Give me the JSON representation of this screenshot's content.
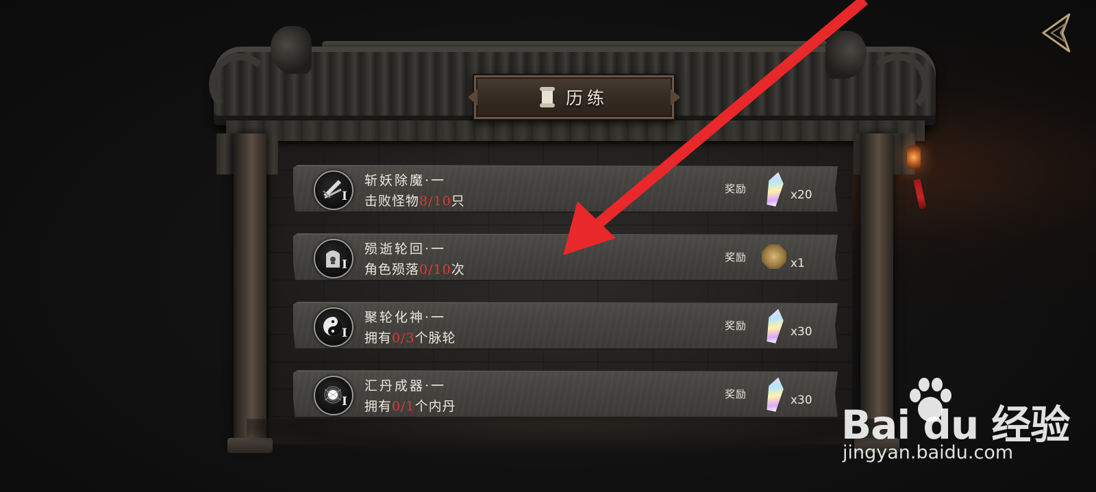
{
  "title": "历练",
  "tasks": [
    {
      "name": "斩妖除魔·一",
      "desc_prefix": "击败怪物",
      "progress": "8/10",
      "desc_suffix": "只",
      "roman": "I",
      "icon": "blade-icon",
      "reward_label": "奖励",
      "reward_item": "crystal-icon",
      "reward_qty": "x20"
    },
    {
      "name": "殒逝轮回·一",
      "desc_prefix": "角色殒落",
      "progress": "0/10",
      "desc_suffix": "次",
      "roman": "I",
      "icon": "tombstone-icon",
      "reward_label": "奖励",
      "reward_item": "compass-icon",
      "reward_qty": "x1"
    },
    {
      "name": "聚轮化神·一",
      "desc_prefix": "拥有",
      "progress": "0/3",
      "desc_suffix": "个脉轮",
      "roman": "I",
      "icon": "yin-yang-icon",
      "reward_label": "奖励",
      "reward_item": "crystal-icon",
      "reward_qty": "x30"
    },
    {
      "name": "汇丹成器·一",
      "desc_prefix": "拥有",
      "progress": "0/1",
      "desc_suffix": "个内丹",
      "roman": "I",
      "icon": "glowing-orb-icon",
      "reward_label": "奖励",
      "reward_item": "crystal-icon",
      "reward_qty": "x30"
    }
  ],
  "watermark": {
    "brand_text": "Bai du 经验",
    "url": "jingyan.baidu.com"
  },
  "colors": {
    "progress_red": "#e0393a",
    "text_light": "#ece7dc",
    "annotation_arrow": "#e8282a",
    "panel_bg": "#42413d"
  },
  "icons": {
    "back": "back-arrow-icon",
    "title": "scroll-icon",
    "annotation": "red-arrow-annotation"
  }
}
